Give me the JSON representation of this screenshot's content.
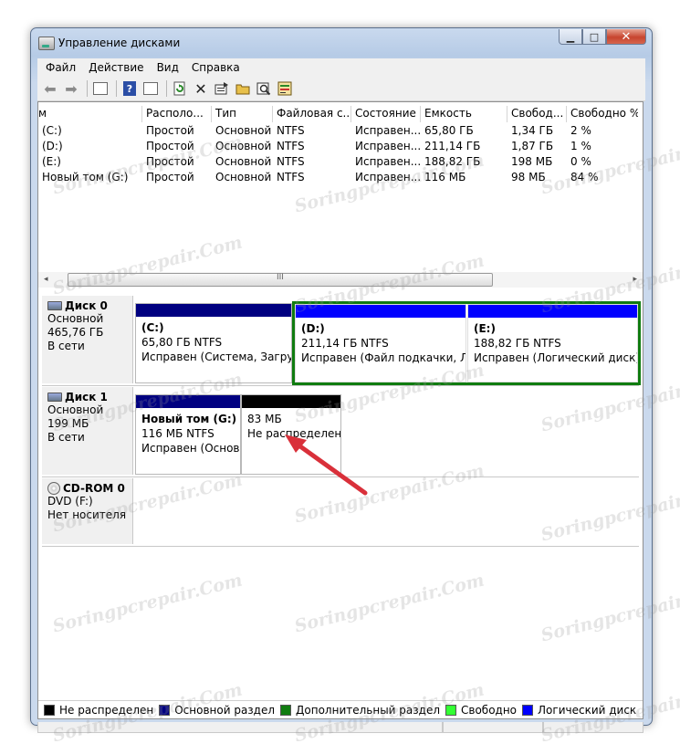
{
  "window": {
    "title": "Управление дисками",
    "caption_min": "▁",
    "caption_max": "□",
    "caption_close": "✕"
  },
  "menu": [
    "Файл",
    "Действие",
    "Вид",
    "Справка"
  ],
  "toolbar": {
    "icons": [
      "back-arrow-icon",
      "forward-arrow-icon",
      "show-hide-console-tree-icon",
      "help-icon",
      "action-pane-icon",
      "refresh-icon",
      "delete-icon",
      "properties-icon",
      "open-icon",
      "rescan-icon",
      "export-icon"
    ]
  },
  "list": {
    "columns": [
      "м",
      "Располо...",
      "Тип",
      "Файловая с...",
      "Состояние",
      "Емкость",
      "Свобод...",
      "Свободно %"
    ],
    "rows": [
      [
        "(C:)",
        "Простой",
        "Основной",
        "NTFS",
        "Исправен...",
        "65,80 ГБ",
        "1,34 ГБ",
        "2 %"
      ],
      [
        "(D:)",
        "Простой",
        "Основной",
        "NTFS",
        "Исправен...",
        "211,14 ГБ",
        "1,87 ГБ",
        "1 %"
      ],
      [
        "(E:)",
        "Простой",
        "Основной",
        "NTFS",
        "Исправен...",
        "188,82 ГБ",
        "198 МБ",
        "0 %"
      ],
      [
        "Новый том (G:)",
        "Простой",
        "Основной",
        "NTFS",
        "Исправен...",
        "116 МБ",
        "98 МБ",
        "84 %"
      ]
    ],
    "scroll_grip": "III",
    "scroll_left": "◂",
    "scroll_right": "▸"
  },
  "disks": [
    {
      "name": "Диск 0",
      "type": "Основной",
      "size": "465,76 ГБ",
      "state": "В сети",
      "partitions": [
        {
          "title": "(C:)",
          "size": "65,80 ГБ NTFS",
          "status": "Исправен (Система, Загрузк",
          "bar": "#000080"
        },
        {
          "title": "(D:)",
          "size": "211,14 ГБ NTFS",
          "status": "Исправен (Файл подкачки, Лог",
          "bar": "#0000ff"
        },
        {
          "title": "(E:)",
          "size": "188,82 ГБ NTFS",
          "status": "Исправен (Логический диск)",
          "bar": "#0000ff"
        }
      ]
    },
    {
      "name": "Диск 1",
      "type": "Основной",
      "size": "199 МБ",
      "state": "В сети",
      "partitions": [
        {
          "title": "Новый том  (G:)",
          "size": "116 МБ NTFS",
          "status": "Исправен (Основн",
          "bar": "#000080"
        },
        {
          "title": "",
          "size": "83 МБ",
          "status": "Не распределен",
          "bar": "#000000"
        }
      ]
    },
    {
      "name": "CD-ROM 0",
      "type": "DVD (F:)",
      "size": "",
      "state": "Нет носителя",
      "partitions": []
    }
  ],
  "legend": [
    {
      "label": "Не распределен",
      "color": "#000000"
    },
    {
      "label": "Основной раздел",
      "color": "#000080"
    },
    {
      "label": "Дополнительный раздел",
      "color": "#107c10"
    },
    {
      "label": "Свободно",
      "color": "#33ff33"
    },
    {
      "label": "Логический диск",
      "color": "#0000ff"
    }
  ],
  "watermark": "Soringpcrepair.Com",
  "colors": {
    "arrow": "#d9303a",
    "extended_border": "#107c10"
  }
}
